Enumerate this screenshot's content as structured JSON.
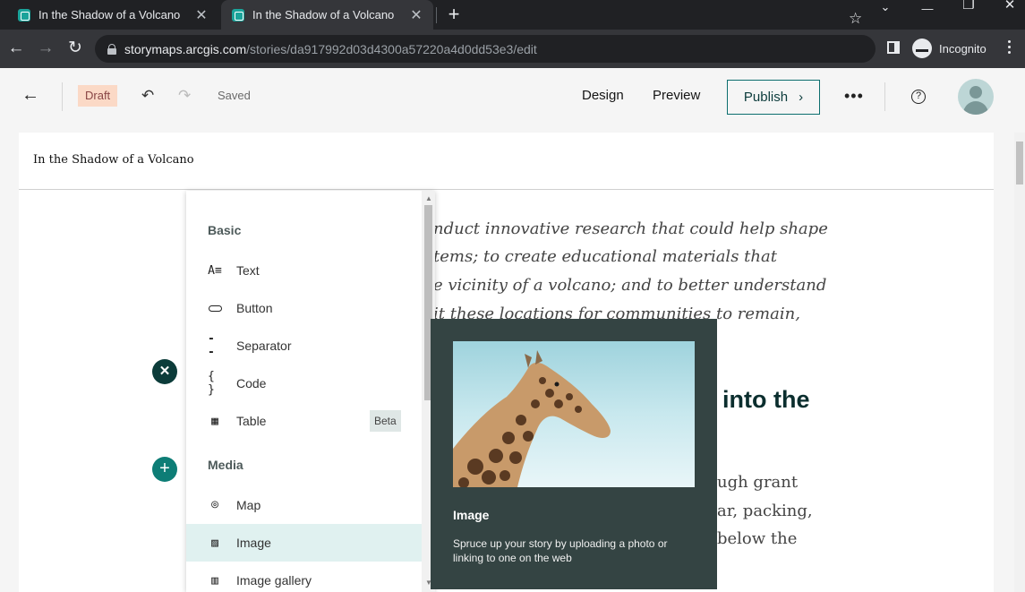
{
  "browser": {
    "tabs": [
      {
        "title": "In the Shadow of a Volcano"
      },
      {
        "title": "In the Shadow of a Volcano"
      }
    ],
    "url_host": "storymaps.arcgis.com",
    "url_path": "/stories/da917992d03d4300a57220a4d0dd53e3/edit",
    "profile_label": "Incognito"
  },
  "header": {
    "status_badge": "Draft",
    "save_status": "Saved",
    "design_label": "Design",
    "preview_label": "Preview",
    "publish_label": "Publish"
  },
  "story": {
    "title": "In the Shadow of a Volcano",
    "italic_lines": [
      "nduct innovative research that could help shape",
      "tems; to create educational materials that",
      "e vicinity of a volcano; and to better understand",
      "it these locations for communities to remain,"
    ],
    "heading_fragment": "into the",
    "body_lines": [
      "ugh grant",
      "ar,  packing,",
      "below the"
    ]
  },
  "block_menu": {
    "sections": [
      {
        "title": "Basic",
        "items": [
          {
            "label": "Text",
            "icon": "text-icon"
          },
          {
            "label": "Button",
            "icon": "button-icon"
          },
          {
            "label": "Separator",
            "icon": "separator-icon"
          },
          {
            "label": "Code",
            "icon": "code-icon"
          },
          {
            "label": "Table",
            "icon": "table-icon",
            "badge": "Beta"
          }
        ]
      },
      {
        "title": "Media",
        "items": [
          {
            "label": "Map",
            "icon": "map-pin-icon"
          },
          {
            "label": "Image",
            "icon": "image-icon",
            "selected": true
          },
          {
            "label": "Image gallery",
            "icon": "image-gallery-icon"
          }
        ]
      }
    ]
  },
  "preview": {
    "title": "Image",
    "description": "Spruce up your story by uploading a photo or linking to one on the web"
  },
  "colors": {
    "accent": "#0d7d76",
    "draft_badge_bg": "#fbd9c6",
    "preview_bg": "#344443",
    "selected_item_bg": "#e0f1f0"
  }
}
